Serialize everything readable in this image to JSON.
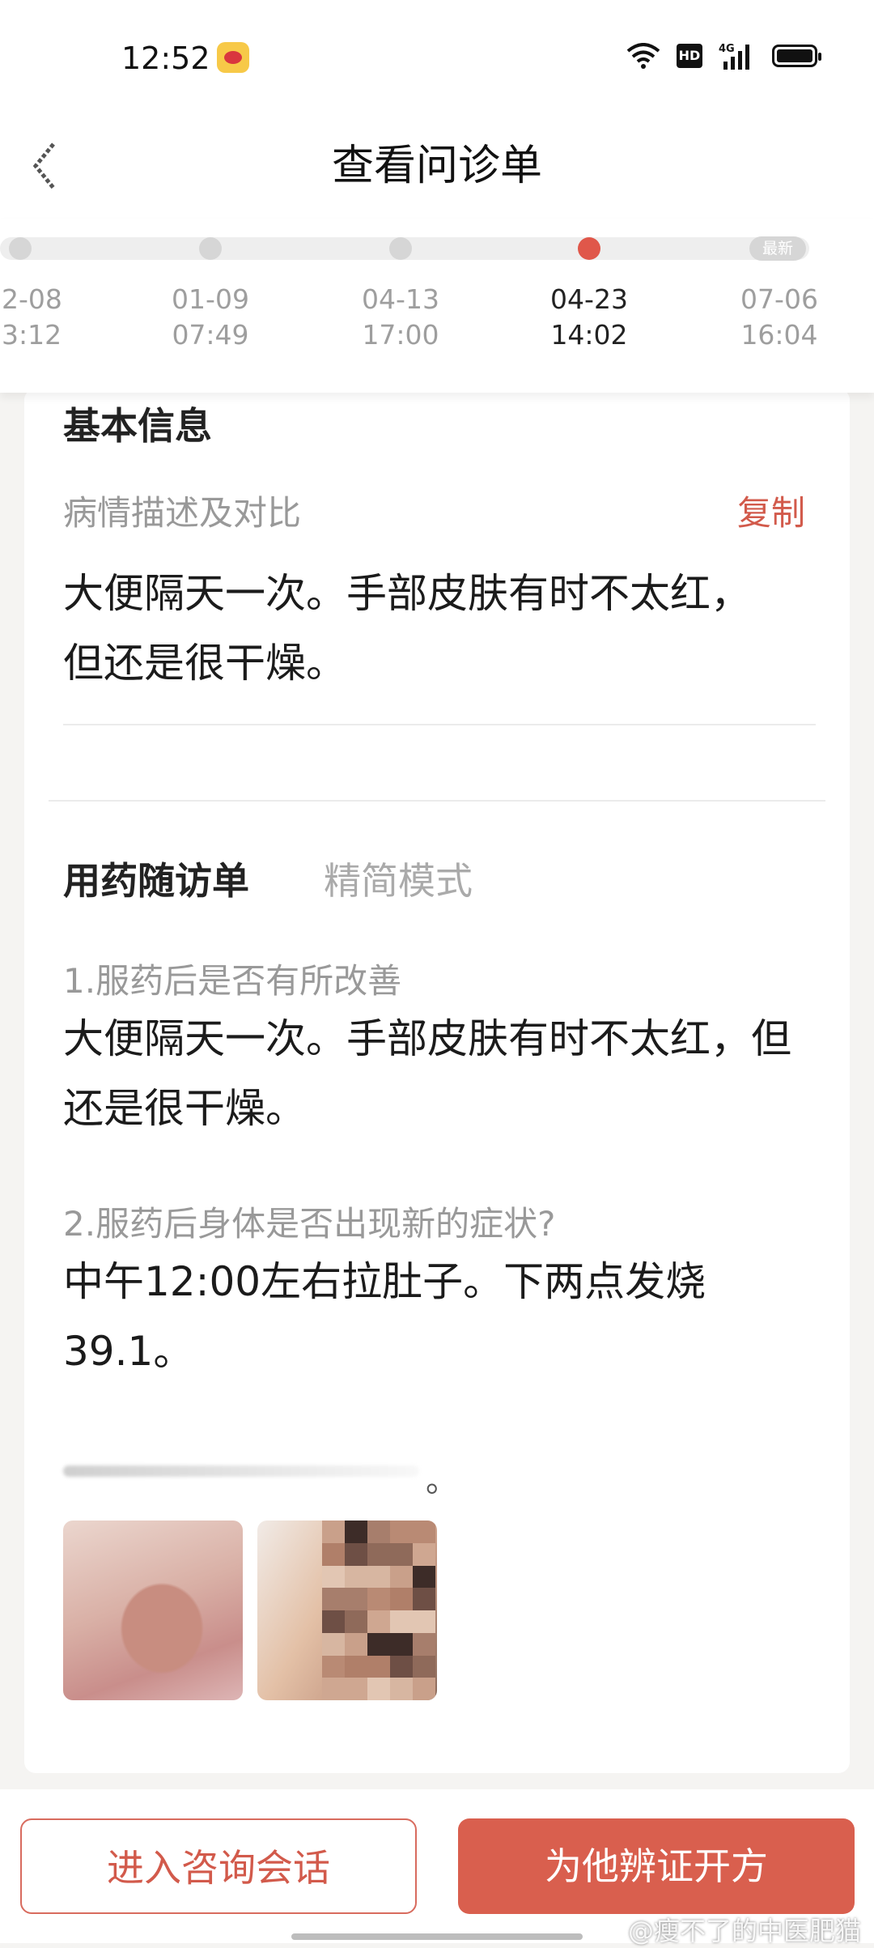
{
  "status_bar": {
    "time": "12:52",
    "network": "4G"
  },
  "header": {
    "title": "查看问诊单"
  },
  "timeline": {
    "latest_tag": "最新",
    "items": [
      {
        "date": "2-08",
        "time": "3:12"
      },
      {
        "date": "01-09",
        "time": "07:49"
      },
      {
        "date": "04-13",
        "time": "17:00"
      },
      {
        "date": "04-23",
        "time": "14:02"
      },
      {
        "date": "07-06",
        "time": "16:04"
      }
    ]
  },
  "basic_info": {
    "title": "基本信息",
    "desc_label": "病情描述及对比",
    "copy_label": "复制",
    "desc_lines": [
      "大便隔天一次。手部皮肤有时不太红，",
      "但还是很干燥。"
    ]
  },
  "followup": {
    "title": "用药随访单",
    "mode_label": "精简模式",
    "questions": [
      {
        "q": "1.服药后是否有所改善",
        "a_lines": [
          "大便隔天一次。手部皮肤有时不太红，但",
          "还是很干燥。"
        ]
      },
      {
        "q": "2.服药后身体是否出现新的症状?",
        "a_lines": [
          "中午12:00左右拉肚子。下两点发烧",
          "39.1。"
        ]
      }
    ],
    "blurred_suffix": "。"
  },
  "actions": {
    "consult": "进入咨询会话",
    "prescribe": "为他辨证开方"
  },
  "watermark": "@瘦不了的中医肥猫",
  "colors": {
    "accent": "#d95f4e",
    "muted": "#999999"
  }
}
